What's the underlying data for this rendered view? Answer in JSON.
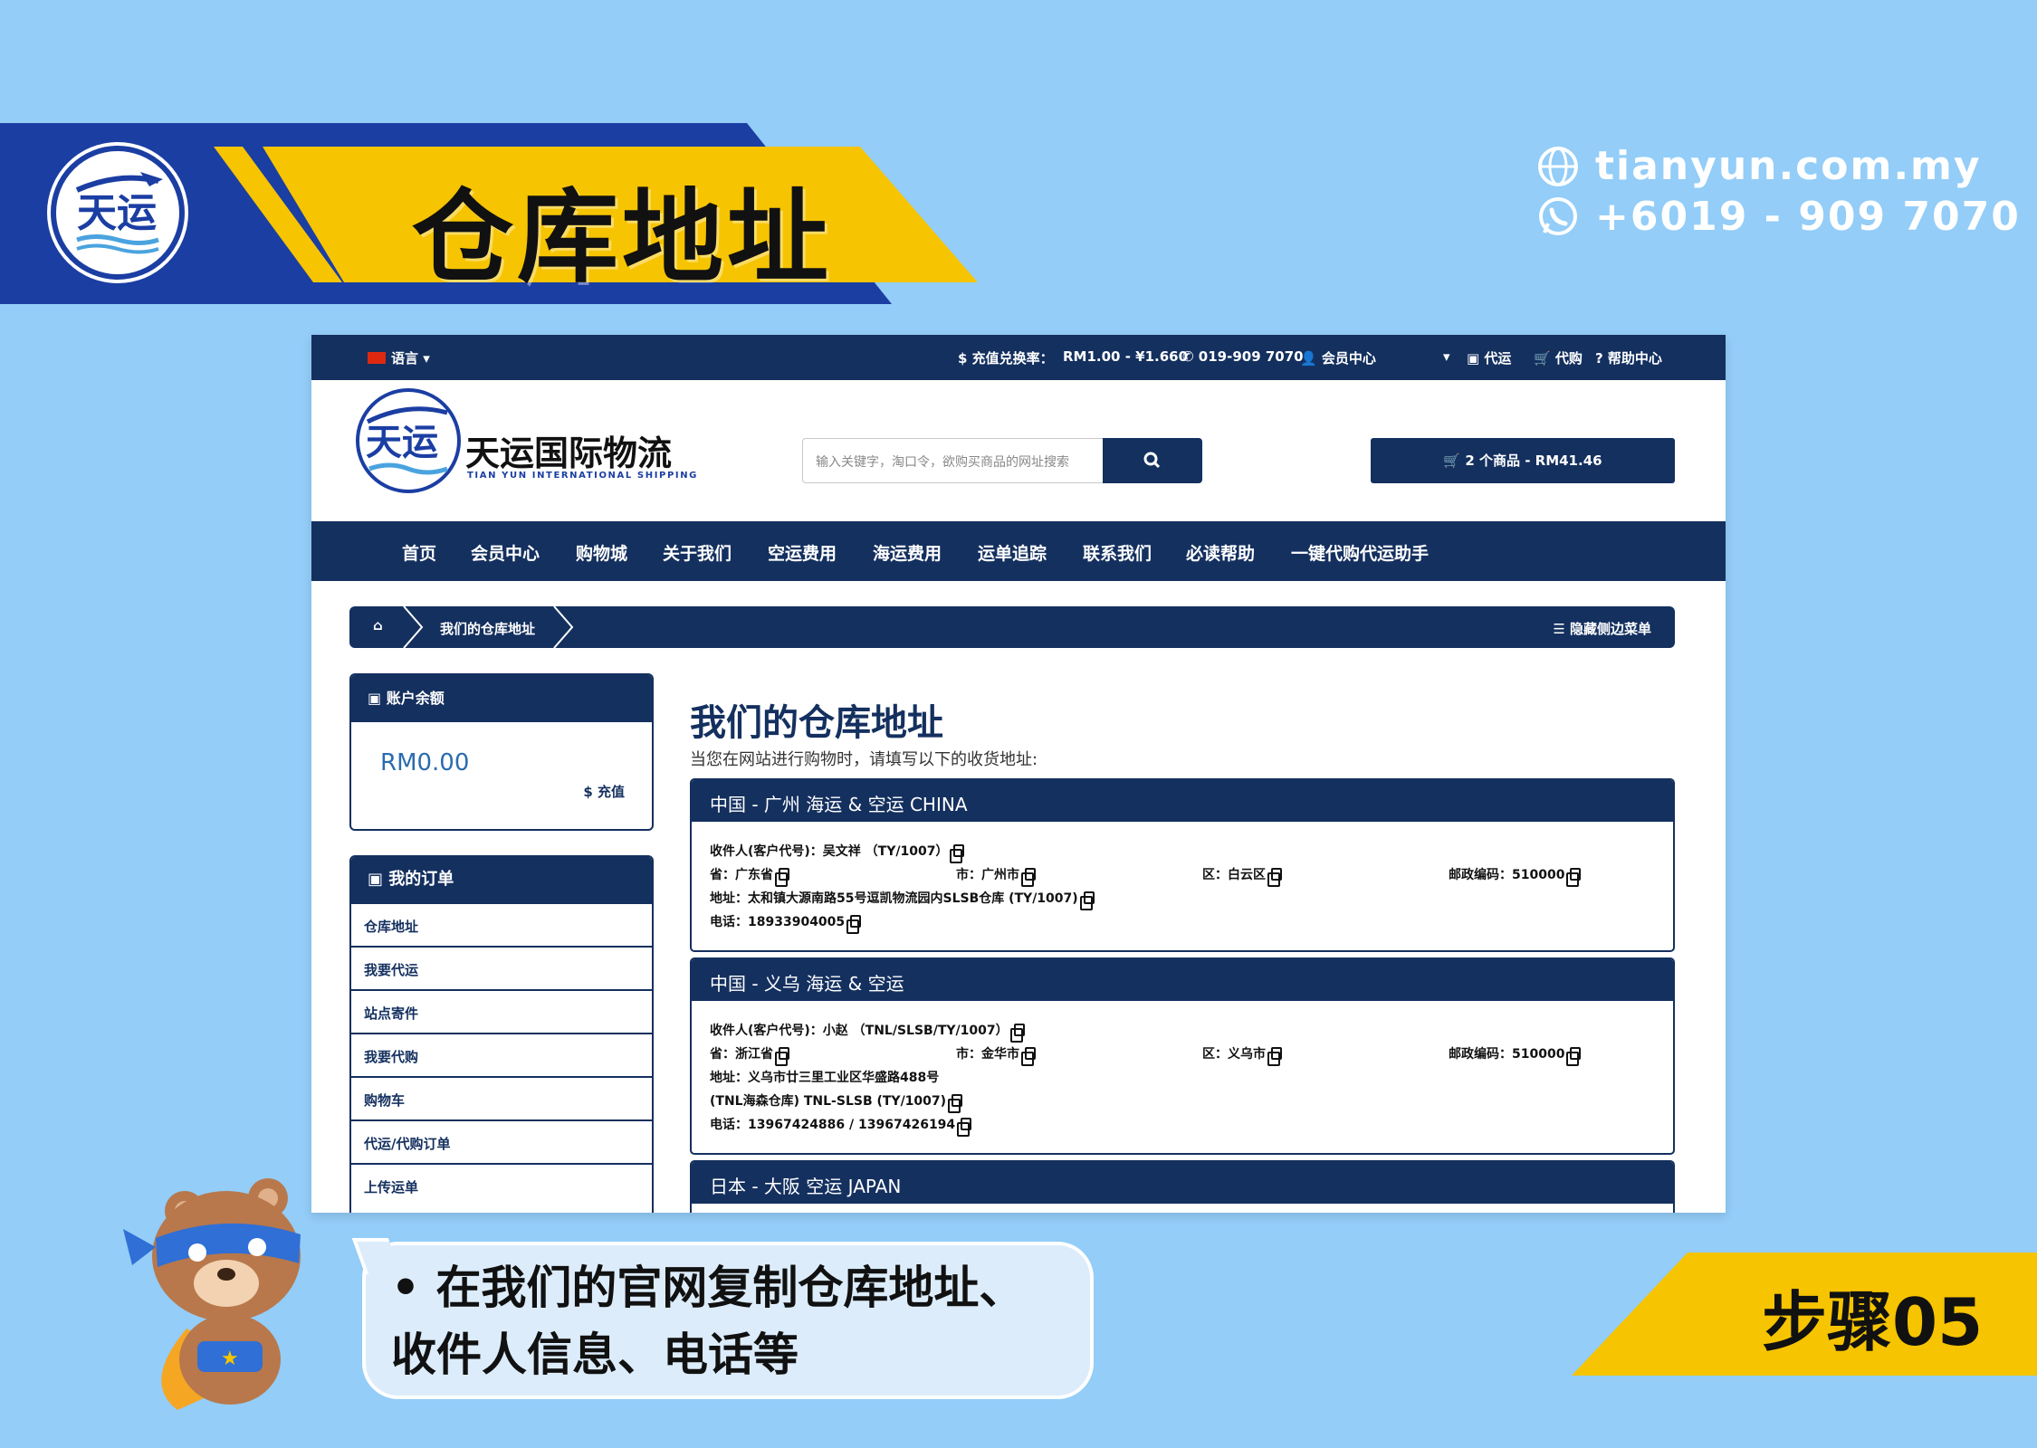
{
  "banner": {
    "title": "仓库地址",
    "website": "tianyun.com.my",
    "phone": "+6019 - 909 7070"
  },
  "topbar": {
    "language": "语言",
    "rate_label": "$ 充值兑换率：",
    "rate_value": "RM1.00 - ¥1.660",
    "phone": "019-909 7070",
    "member": "会员中心",
    "forward": "代运",
    "purchase": "代购",
    "help": "? 帮助中心"
  },
  "header": {
    "brand_cn": "天运国际物流",
    "brand_en": "TIAN YUN INTERNATIONAL SHIPPING",
    "search_placeholder": "输入关键字，淘口令，欲购买商品的网址搜索",
    "cart": "2 个商品 - RM41.46"
  },
  "nav": [
    "首页",
    "会员中心",
    "购物城",
    "关于我们",
    "空运费用",
    "海运费用",
    "运单追踪",
    "联系我们",
    "必读帮助",
    "一键代购代运助手"
  ],
  "breadcrumb": {
    "current": "我们的仓库地址",
    "toggle": "隐藏侧边菜单"
  },
  "balance": {
    "title": "账户余额",
    "amount": "RM0.00",
    "topup": "$ 充值"
  },
  "orders": {
    "title": "我的订单",
    "items": [
      "仓库地址",
      "我要代运",
      "站点寄件",
      "我要代购",
      "购物车",
      "代运/代购订单",
      "上传运单"
    ]
  },
  "main": {
    "title": "我们的仓库地址",
    "subtitle": "当您在网站进行购物时，请填写以下的收货地址:"
  },
  "warehouses": [
    {
      "name": "中国 - 广州 海运 & 空运 CHINA",
      "recipient": "收件人(客户代号)：吴文祥 （TY/1007）",
      "province": "省：广东省",
      "city": "市：广州市",
      "district": "区：白云区",
      "postcode": "邮政编码：510000",
      "address": "地址：太和镇大源南路55号逗凯物流园内SLSB仓库 (TY/1007)",
      "phone": "电话：18933904005"
    },
    {
      "name": "中国 - 义乌 海运 & 空运",
      "recipient": "收件人(客户代号)：小赵 （TNL/SLSB/TY/1007）",
      "province": "省：浙江省",
      "city": "市：金华市",
      "district": "区：义乌市",
      "postcode": "邮政编码：510000",
      "address": "地址：义乌市廿三里工业区华盛路488号",
      "address2": "(TNL海森仓库) TNL-SLSB (TY/1007)",
      "phone": "电话：13967424886 / 13967426194"
    },
    {
      "name": "日本 - 大阪 空运 JAPAN"
    }
  ],
  "bubble": {
    "line1": "• 在我们的官网复制仓库地址、",
    "line2": "收件人信息、电话等"
  },
  "step": "步骤05"
}
